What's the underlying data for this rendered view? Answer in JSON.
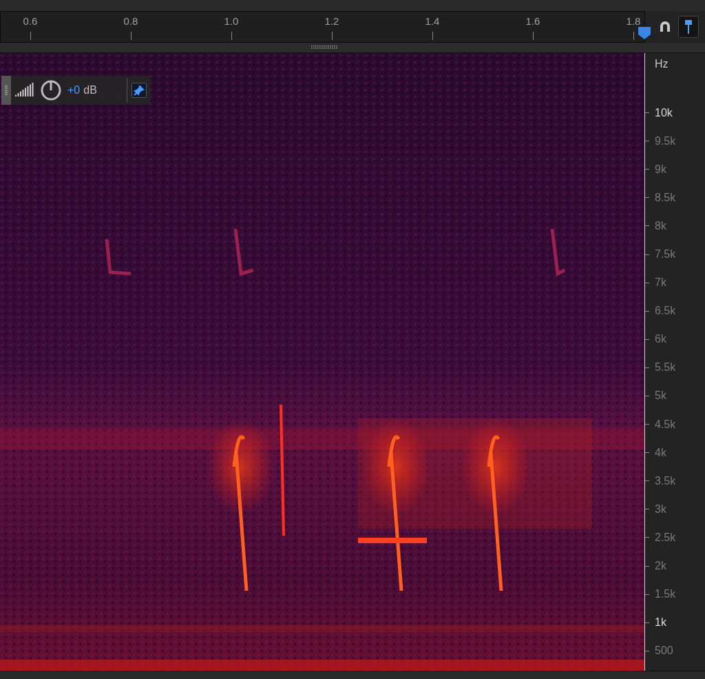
{
  "time_ruler": {
    "labels": [
      "0.6",
      "0.8",
      "1.0",
      "1.2",
      "1.4",
      "1.6",
      "1.8"
    ]
  },
  "toolbar": {
    "snap_on": false,
    "pin_on": true
  },
  "hud": {
    "gain_value": "+0",
    "gain_unit": "dB",
    "pin_on": true
  },
  "frequency_axis": {
    "unit": "Hz",
    "labels": [
      {
        "text": "10k",
        "major": true
      },
      {
        "text": "9.5k",
        "major": false
      },
      {
        "text": "9k",
        "major": false
      },
      {
        "text": "8.5k",
        "major": false
      },
      {
        "text": "8k",
        "major": false
      },
      {
        "text": "7.5k",
        "major": false
      },
      {
        "text": "7k",
        "major": false
      },
      {
        "text": "6.5k",
        "major": false
      },
      {
        "text": "6k",
        "major": false
      },
      {
        "text": "5.5k",
        "major": false
      },
      {
        "text": "5k",
        "major": false
      },
      {
        "text": "4.5k",
        "major": false
      },
      {
        "text": "4k",
        "major": false
      },
      {
        "text": "3.5k",
        "major": false
      },
      {
        "text": "3k",
        "major": false
      },
      {
        "text": "2.5k",
        "major": false
      },
      {
        "text": "2k",
        "major": false
      },
      {
        "text": "1.5k",
        "major": false
      },
      {
        "text": "1k",
        "major": true
      },
      {
        "text": "500",
        "major": false
      }
    ]
  }
}
